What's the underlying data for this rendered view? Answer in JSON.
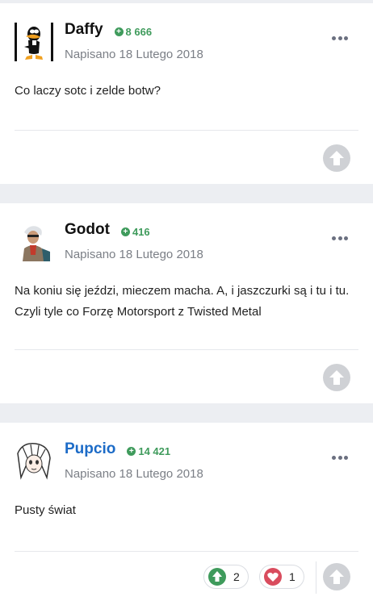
{
  "posts": [
    {
      "author": "Daffy",
      "reputation": "8 666",
      "date": "Napisano 18 Lutego 2018",
      "content": "Co laczy sotc i zelde botw?",
      "avatar_icon": "daffy-duck-avatar"
    },
    {
      "author": "Godot",
      "reputation": "416",
      "date": "Napisano 18 Lutego 2018",
      "content": "Na koniu się jeździ, mieczem macha. A, i jaszczurki są i tu i tu. Czyli tyle co Forzę Motorsport z Twisted Metal",
      "avatar_icon": "godot-character-avatar"
    },
    {
      "author": "Pupcio",
      "reputation": "14 421",
      "date": "Napisano 18 Lutego 2018",
      "content": "Pusty świat",
      "avatar_icon": "anime-girl-avatar",
      "reactions": [
        {
          "type": "upvote",
          "count": "2",
          "color": "#3f9b5c"
        },
        {
          "type": "heart",
          "count": "1",
          "color": "#d94c5e"
        }
      ]
    }
  ],
  "colors": {
    "reputation": "#3f9b5c",
    "highlight_author": "#1c6bc7",
    "page_background": "#eceef2"
  }
}
